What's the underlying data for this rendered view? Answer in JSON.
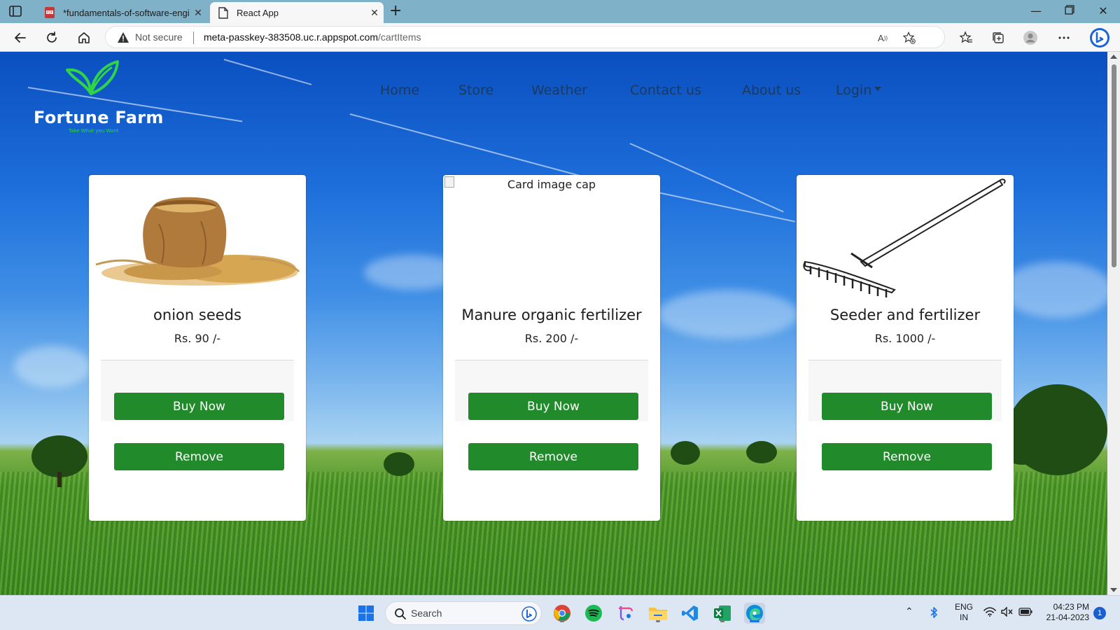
{
  "browser": {
    "tabs": [
      {
        "title": "*fundamentals-of-software-engi",
        "icon": "pdf-icon",
        "active": false
      },
      {
        "title": "React App",
        "icon": "page-icon",
        "active": true
      }
    ],
    "address": {
      "security": "Not secure",
      "host": "meta-passkey-383508.uc.r.appspot.com",
      "path": "/cartItems"
    },
    "read_aloud_label": "A"
  },
  "site": {
    "logo_text": "Fortune Farm",
    "logo_tagline": "Take What you Want",
    "nav": {
      "home": "Home",
      "store": "Store",
      "weather": "Weather",
      "contact": "Contact us",
      "about": "About us",
      "login": "Login"
    }
  },
  "cart": {
    "items": [
      {
        "name": "onion seeds",
        "price": "Rs. 90 /-",
        "image": "grain-sack-image",
        "image_alt": "",
        "buy_label": "Buy Now",
        "remove_label": "Remove"
      },
      {
        "name": "Manure organic fertilizer",
        "price": "Rs. 200 /-",
        "image": "broken-image",
        "image_alt": "Card image cap",
        "buy_label": "Buy Now",
        "remove_label": "Remove"
      },
      {
        "name": "Seeder and fertilizer",
        "price": "Rs. 1000 /-",
        "image": "rake-image",
        "image_alt": "",
        "buy_label": "Buy Now",
        "remove_label": "Remove"
      }
    ]
  },
  "taskbar": {
    "search_placeholder": "Search",
    "language_line1": "ENG",
    "language_line2": "IN",
    "time": "04:23 PM",
    "date": "21-04-2023",
    "notification_count": "1"
  },
  "colors": {
    "button_green": "#218b2b",
    "nav_text": "#1b3a5c",
    "tabbar": "#7fb2c9",
    "logo_leaf": "#2fd447"
  }
}
